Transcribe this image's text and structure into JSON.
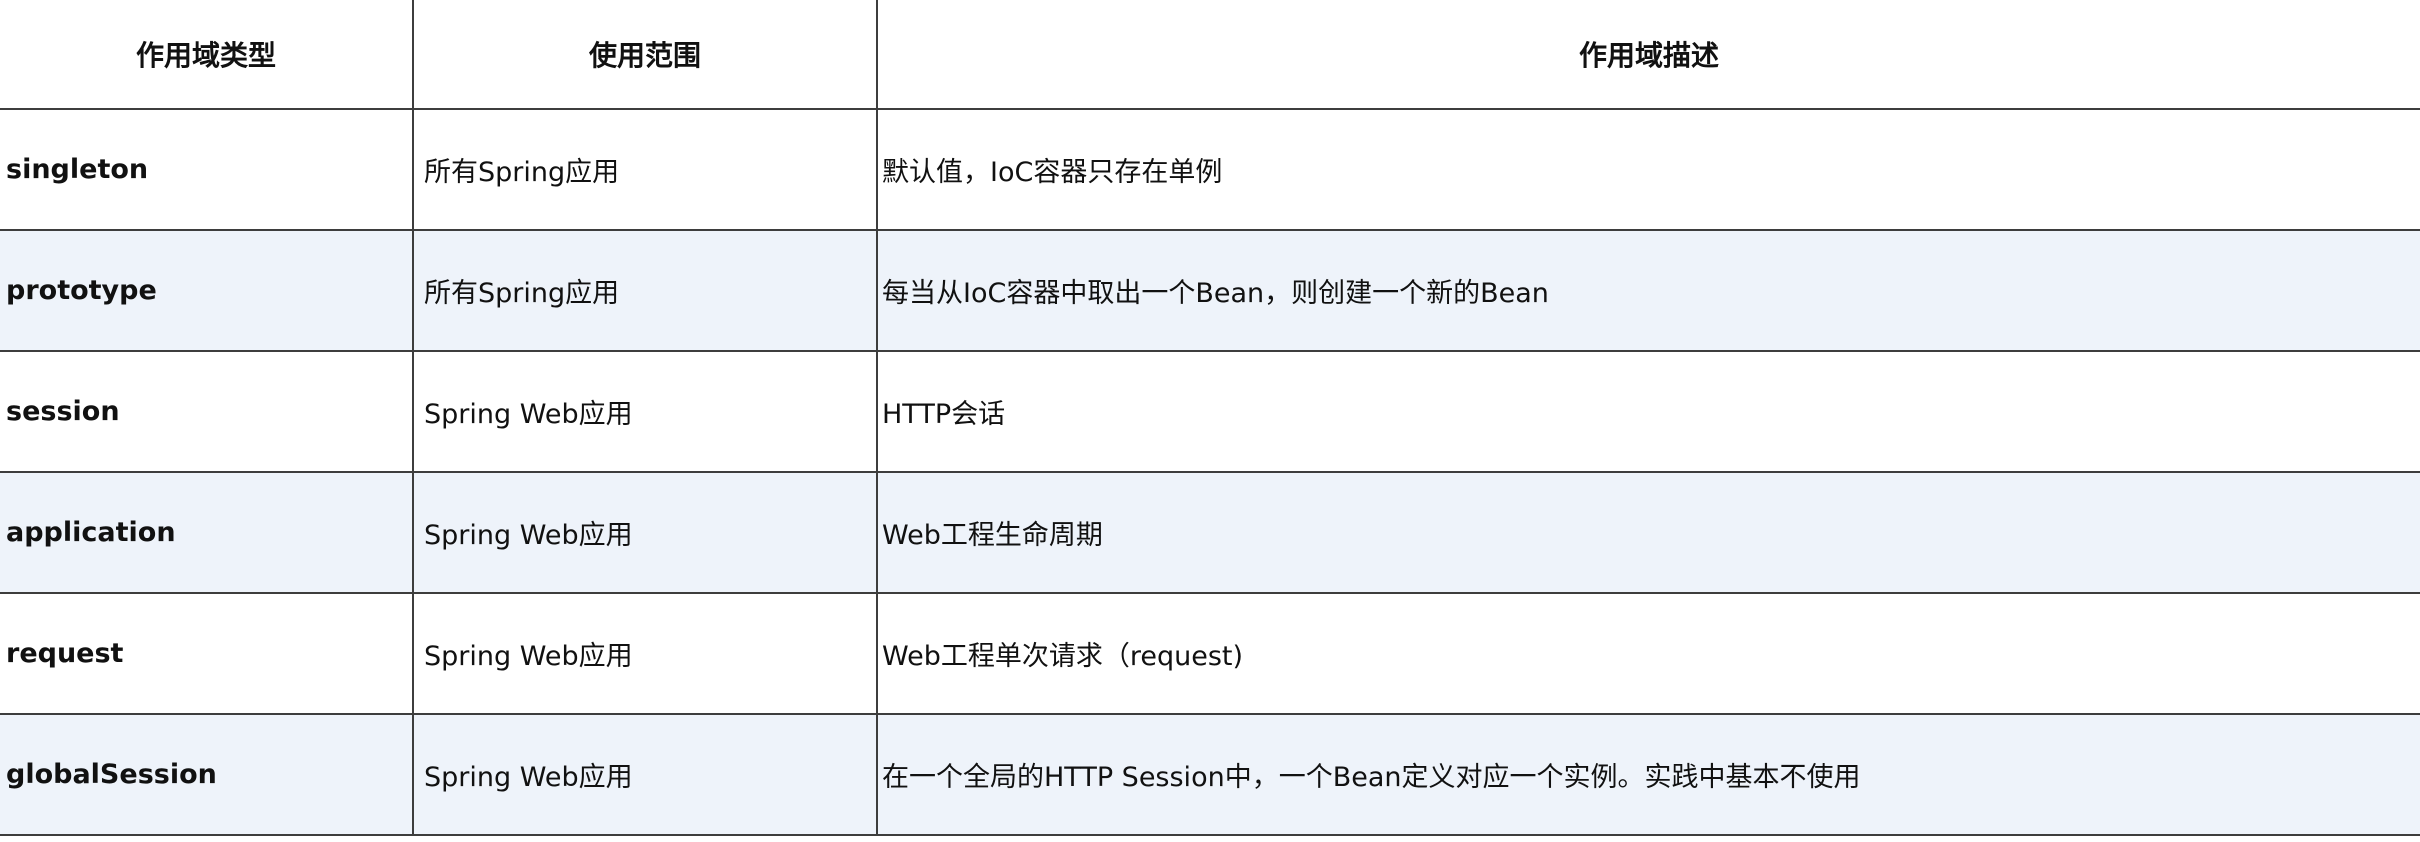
{
  "table": {
    "headers": [
      "作用域类型",
      "使用范围",
      "作用域描述"
    ],
    "rows": [
      {
        "type": "singleton",
        "scope": "所有Spring应用",
        "desc": "默认值，IoC容器只存在单例"
      },
      {
        "type": "prototype",
        "scope": "所有Spring应用",
        "desc": "每当从IoC容器中取出一个Bean，则创建一个新的Bean"
      },
      {
        "type": "session",
        "scope": "Spring Web应用",
        "desc": "HTTP会话"
      },
      {
        "type": "application",
        "scope": "Spring Web应用",
        "desc": "Web工程生命周期"
      },
      {
        "type": "request",
        "scope": "Spring Web应用",
        "desc": "Web工程单次请求（request)"
      },
      {
        "type": "globalSession",
        "scope": "Spring Web应用",
        "desc": "在一个全局的HTTP Session中，一个Bean定义对应一个实例。实践中基本不使用"
      }
    ]
  },
  "colors": {
    "border": "#3d3d3d",
    "row_alt_background": "#eef3fa",
    "text": "#111111"
  }
}
